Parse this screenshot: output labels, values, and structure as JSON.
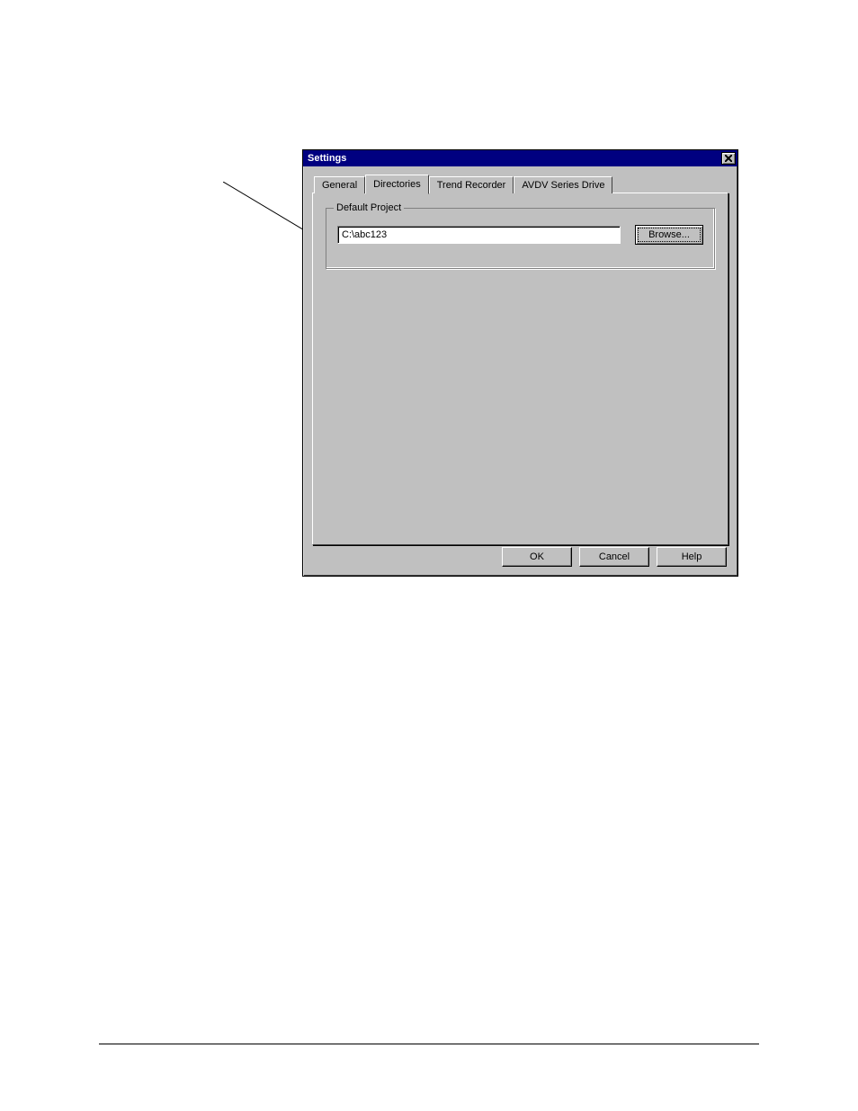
{
  "dialog": {
    "title": "Settings",
    "tabs": {
      "general": "General",
      "directories": "Directories",
      "trend_recorder": "Trend Recorder",
      "avdv_drive": "AVDV Series Drive"
    },
    "group_label": "Default Project",
    "path_value": "C:\\abc123",
    "browse_label": "Browse...",
    "ok_label": "OK",
    "cancel_label": "Cancel",
    "help_label": "Help"
  }
}
